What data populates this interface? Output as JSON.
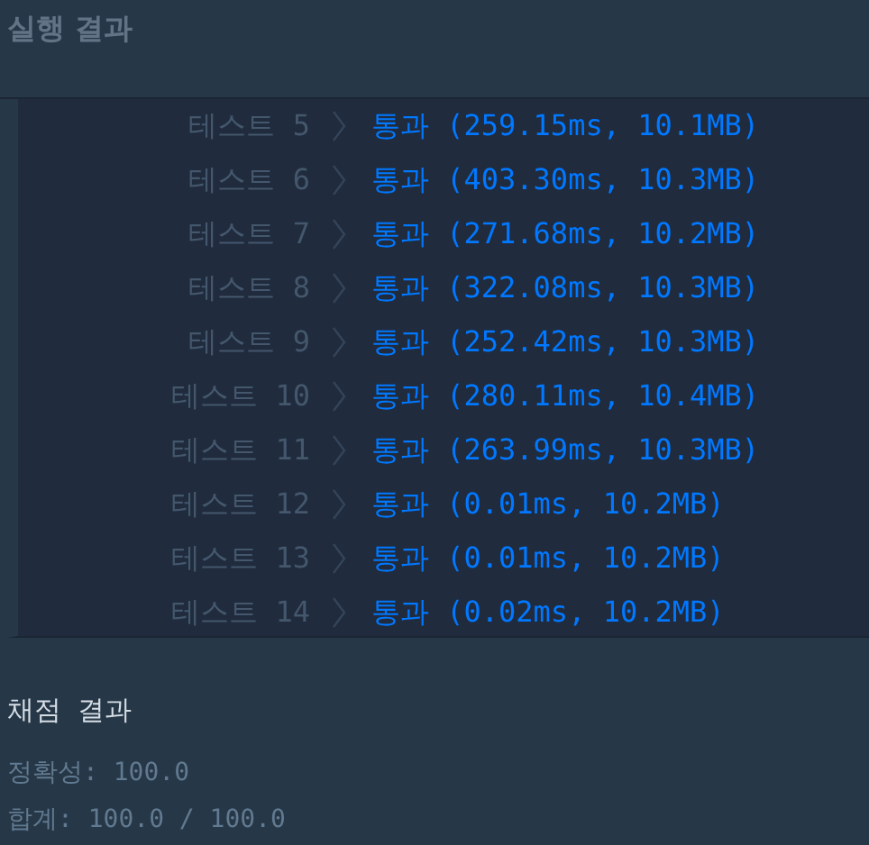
{
  "header": {
    "title": "실행 결과"
  },
  "tests": [
    {
      "label": "테스트 5",
      "result": "통과 (259.15ms, 10.1MB)"
    },
    {
      "label": "테스트 6",
      "result": "통과 (403.30ms, 10.3MB)"
    },
    {
      "label": "테스트 7",
      "result": "통과 (271.68ms, 10.2MB)"
    },
    {
      "label": "테스트 8",
      "result": "통과 (322.08ms, 10.3MB)"
    },
    {
      "label": "테스트 9",
      "result": "통과 (252.42ms, 10.3MB)"
    },
    {
      "label": "테스트 10",
      "result": "통과 (280.11ms, 10.4MB)"
    },
    {
      "label": "테스트 11",
      "result": "통과 (263.99ms, 10.3MB)"
    },
    {
      "label": "테스트 12",
      "result": "통과 (0.01ms, 10.2MB)"
    },
    {
      "label": "테스트 13",
      "result": "통과 (0.01ms, 10.2MB)"
    },
    {
      "label": "테스트 14",
      "result": "통과 (0.02ms, 10.2MB)"
    }
  ],
  "grading": {
    "title": "채점 결과",
    "lines": [
      "정확성: 100.0",
      "합계: 100.0 / 100.0"
    ]
  }
}
